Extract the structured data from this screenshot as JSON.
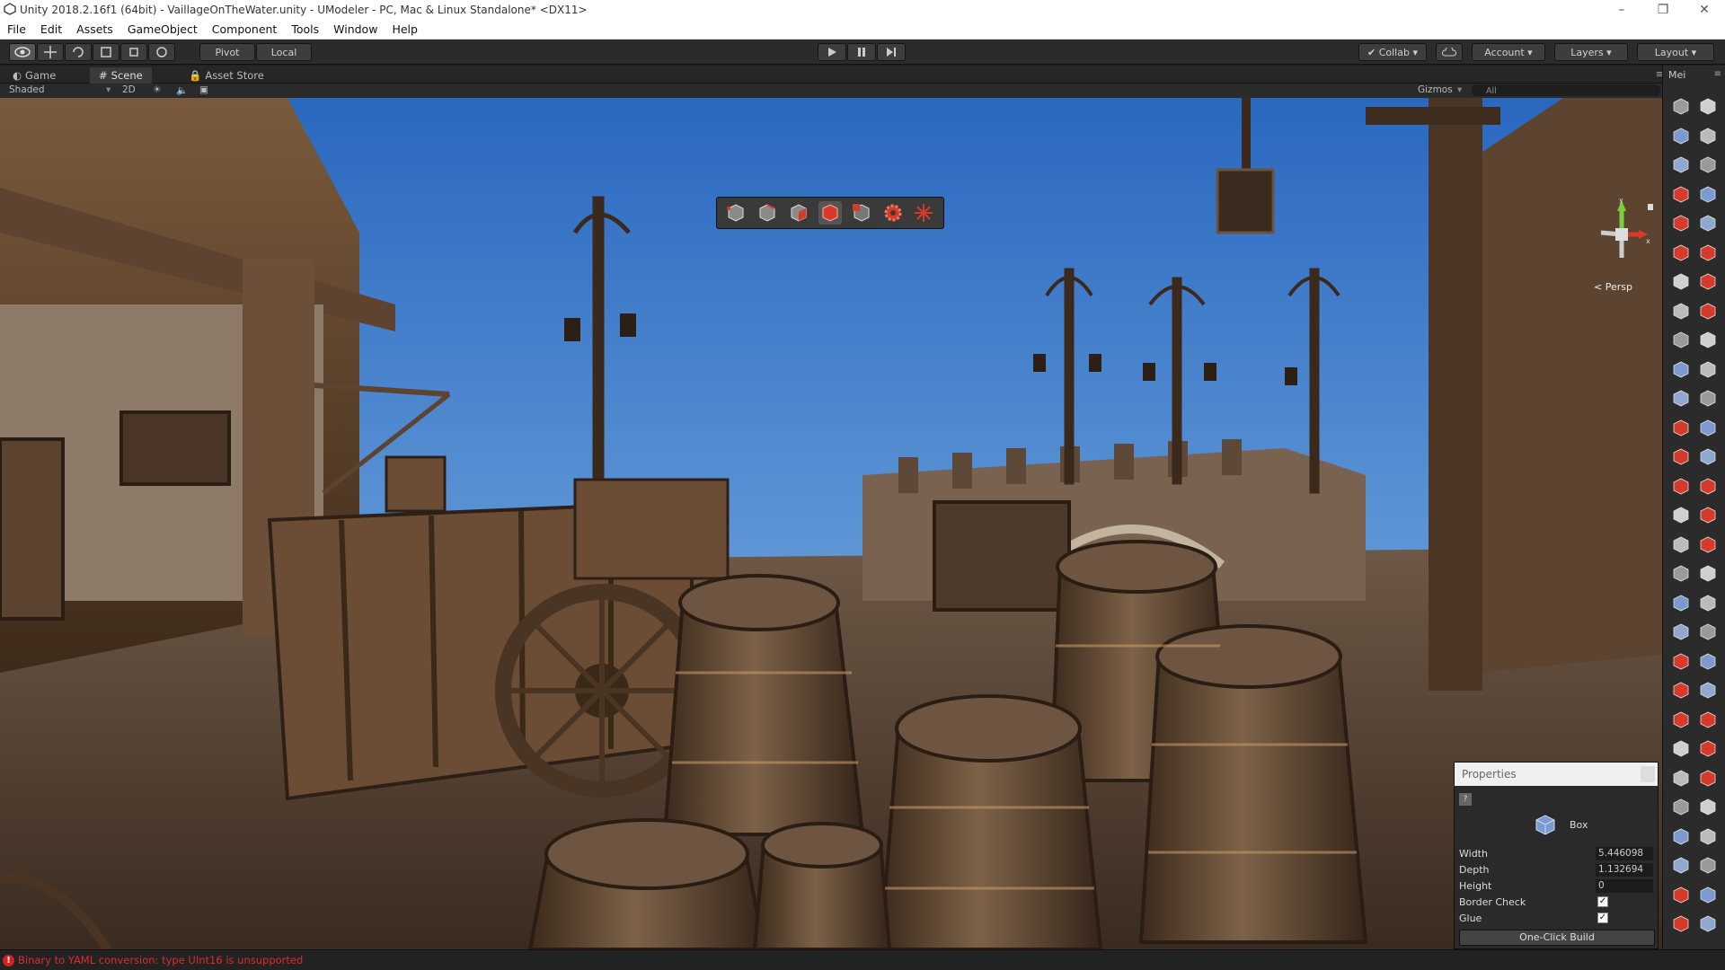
{
  "window": {
    "title": "Unity 2018.2.16f1 (64bit) - VaillageOnTheWater.unity - UModeler - PC, Mac & Linux Standalone* <DX11>",
    "controls": [
      "–",
      "❐",
      "✕"
    ]
  },
  "menu": [
    "File",
    "Edit",
    "Assets",
    "GameObject",
    "Component",
    "Tools",
    "Window",
    "Help"
  ],
  "toolbar": {
    "pivot": "Pivot",
    "local": "Local",
    "collab": "Collab",
    "account": "Account",
    "layers": "Layers",
    "layout": "Layout"
  },
  "tabs": {
    "game": "Game",
    "scene": "Scene",
    "asset_store": "Asset Store",
    "right_panel": "Mei"
  },
  "scene_bar": {
    "shading": "Shaded",
    "mode_2d": "2D",
    "gizmos": "Gizmos",
    "search_placeholder": "All"
  },
  "gizmo": {
    "projection": "Persp"
  },
  "properties": {
    "title": "Properties",
    "help": "?",
    "shape": "Box",
    "fields": [
      {
        "label": "Width",
        "value": "5.446098"
      },
      {
        "label": "Depth",
        "value": "1.132694"
      },
      {
        "label": "Height",
        "value": "0"
      }
    ],
    "checks": [
      {
        "label": "Border Check",
        "checked": "✓"
      },
      {
        "label": "Glue",
        "checked": "✓"
      }
    ],
    "build_button": "One-Click Build"
  },
  "status": {
    "error": "Binary to YAML conversion: type UInt16 is unsupported",
    "error_color": "#e02b2b"
  },
  "colors": {
    "sky_top": "#2d6fc4",
    "sky_bottom": "#8cb8e0",
    "wood": "#6b4a30",
    "accent_red": "#d63a2a"
  }
}
